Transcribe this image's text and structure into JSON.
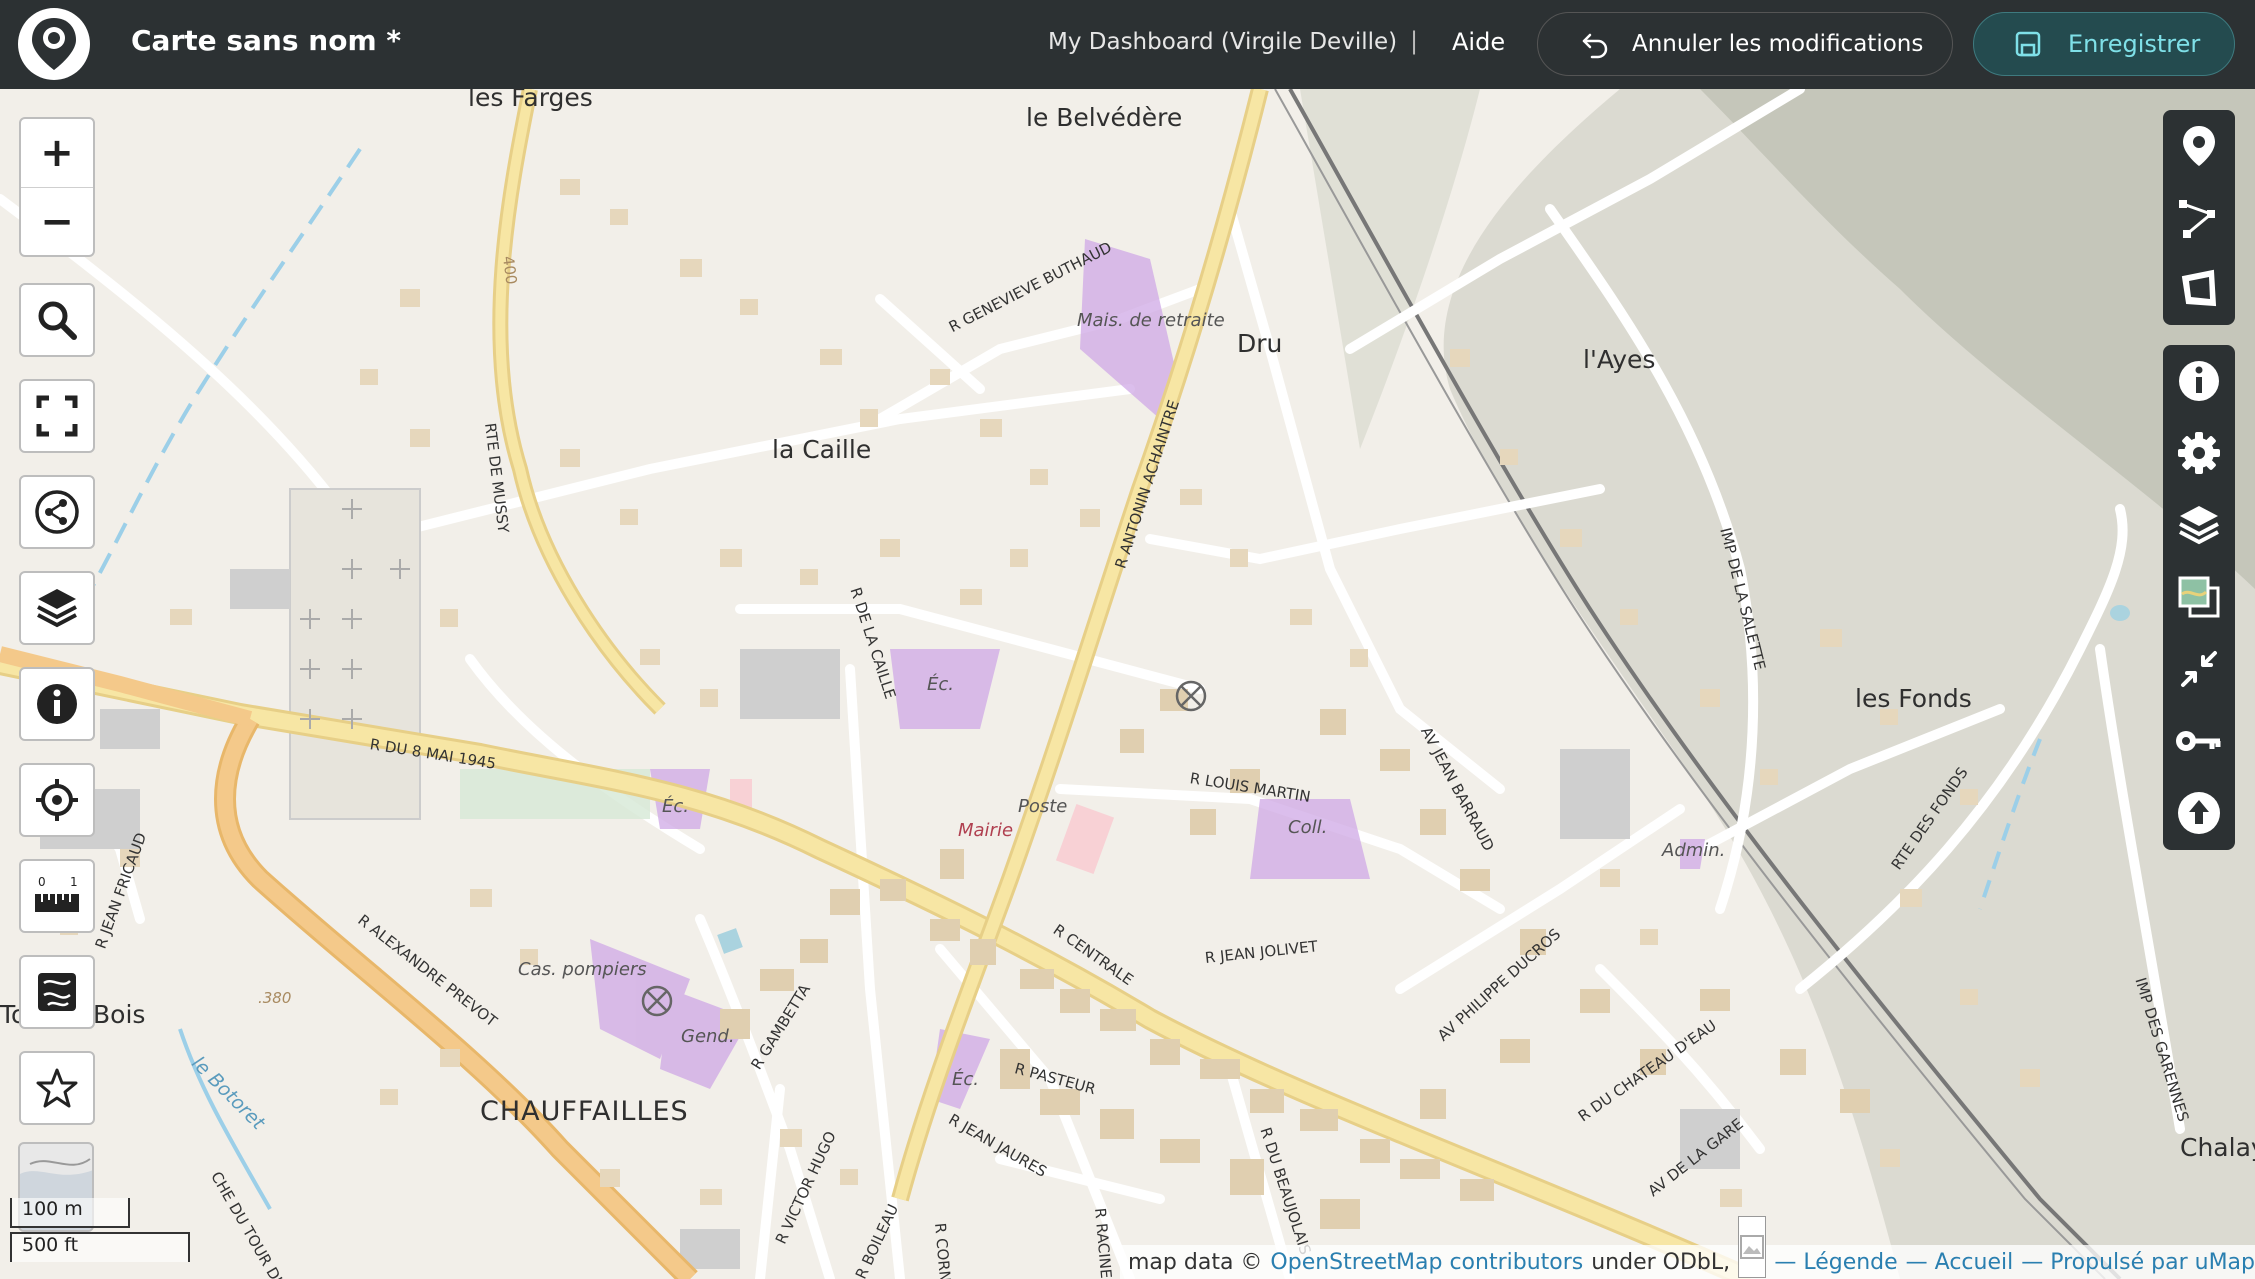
{
  "header": {
    "title": "Carte sans nom *",
    "dashboard": "My Dashboard (Virgile Deville)",
    "separator": "|",
    "help": "Aide",
    "cancel_label": "Annuler les modifications",
    "save_label": "Enregistrer"
  },
  "map": {
    "places": {
      "les_farges": "les Farges",
      "belvedere": "le Belvédère",
      "dru": "Dru",
      "ayes": "l'Ayes",
      "la_caille": "la Caille",
      "les_fonds": "les Fonds",
      "chauffailles": "CHAUFFAILLES",
      "bois": "Bois",
      "to": "To",
      "chalay": "Chalay"
    },
    "streets": {
      "genevieve": "R GENEVIEVE BUTHAUD",
      "antonin": "R ANTONIN ACHAINTRE",
      "mussy": "RTE DE MUSSY",
      "caille": "R DE LA CAILLE",
      "mai": "R DU 8 MAI 1945",
      "louis": "R LOUIS MARTIN",
      "barraud": "AV JEAN BARRAUD",
      "salette": "IMP DE LA SALETTE",
      "fonds": "RTE DES FONDS",
      "fricaud": "R JEAN FRICAUD",
      "prevot": "R ALEXANDRE PREVOT",
      "gambetta": "R GAMBETTA",
      "centrale": "R CENTRALE",
      "jolivet": "R JEAN JOLIVET",
      "ducros": "AV PHILIPPE DUCROS",
      "chateau": "R DU CHATEAU D'EAU",
      "gare": "AV DE LA GARE",
      "garennes": "IMP DES GARENNES",
      "pasteur": "R PASTEUR",
      "jaures": "R JEAN JAURES",
      "hugo": "R VICTOR HUGO",
      "boileau": "R BOILEAU",
      "beaujolais": "R DU BEAUJOLAIS",
      "tour": "CHE DU TOUR DU",
      "racine": "R RACINE",
      "corne": "R CORNE",
      "botoret": "le Botoret",
      "n400": "400",
      "n380": ".380"
    },
    "pois": {
      "retraite": "Mais. de retraite",
      "ec1": "Éc.",
      "ec2": "Éc.",
      "ec3": "Éc.",
      "poste": "Poste",
      "mairie": "Mairie",
      "coll": "Coll.",
      "admin": "Admin.",
      "pompiers": "Cas. pompiers",
      "gend": "Gend."
    }
  },
  "left_controls": {
    "zoom_in": "+",
    "zoom_out": "−"
  },
  "scale": {
    "metric": "100 m",
    "imperial": "500 ft"
  },
  "attribution": {
    "prefix": "map data ©",
    "osm": "OpenStreetMap contributors",
    "license": "under ODbL,",
    "legend": "— Légende",
    "home": "— Accueil",
    "powered": "— Propulsé par uMap"
  },
  "colors": {
    "header_bg": "#2c3133",
    "save_accent": "#7fe0e8",
    "link": "#2a7fb0",
    "poi_purple": "#cfa8e6",
    "main_road": "#f5dc8e",
    "trunk_road": "#f2c27a",
    "building": "#e0cfb0"
  }
}
